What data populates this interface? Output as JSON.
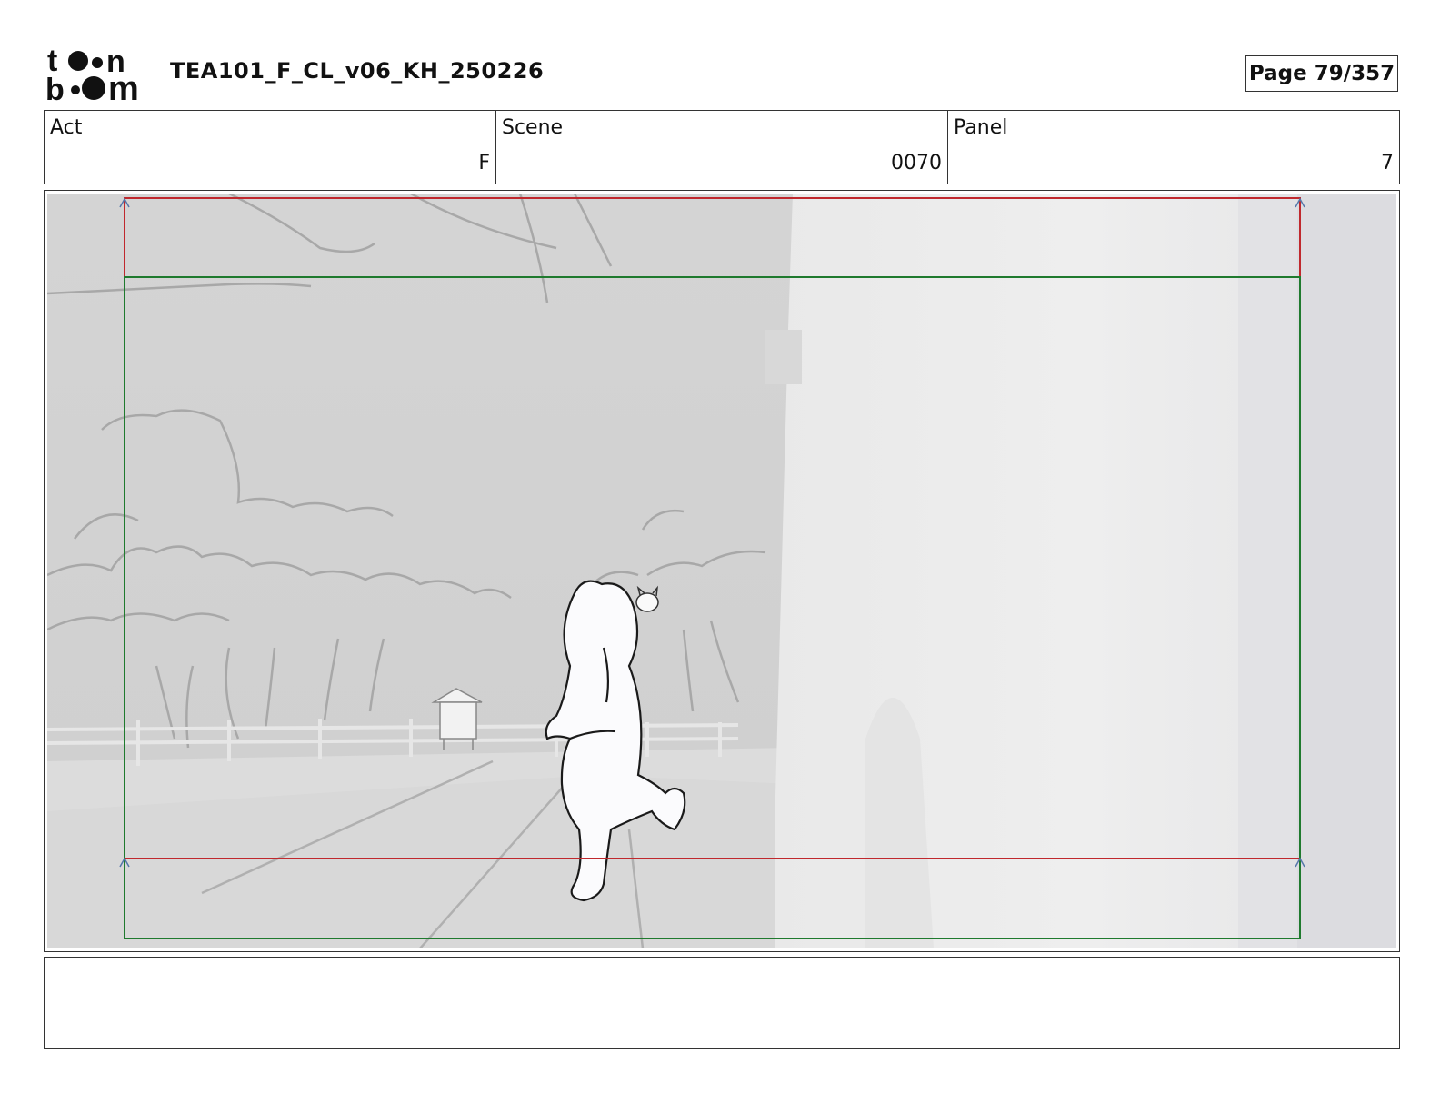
{
  "header": {
    "logo_alt": "toon boom",
    "title": "TEA101_F_CL_v06_KH_250226",
    "page_label": "Page",
    "page_value": "79/357"
  },
  "info": {
    "act": {
      "label": "Act",
      "value": "F"
    },
    "scene": {
      "label": "Scene",
      "value": "0070"
    },
    "panel": {
      "label": "Panel",
      "value": "7"
    }
  },
  "colors": {
    "safe_frame": "#c0282d",
    "camera_frame": "#1f7a2e",
    "border": "#333333"
  },
  "notes": {
    "text": ""
  }
}
